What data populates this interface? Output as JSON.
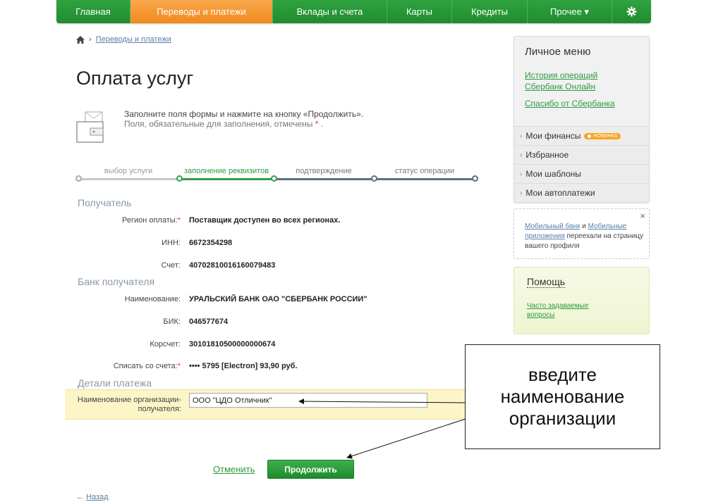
{
  "nav": {
    "items": [
      {
        "label": "Главная"
      },
      {
        "label": "Переводы и платежи"
      },
      {
        "label": "Вклады и счета"
      },
      {
        "label": "Карты"
      },
      {
        "label": "Кредиты"
      },
      {
        "label": "Прочее ▾"
      }
    ],
    "settings_icon": "gear-icon",
    "active_color": "#f39a2e",
    "base_color": "#21a038"
  },
  "breadcrumb": {
    "home_icon": "home-icon",
    "separator": "›",
    "link": "Переводы и платежи"
  },
  "page": {
    "title": "Оплата услуг"
  },
  "info": {
    "icon": "wallet-icon",
    "line1": "Заполните поля формы и нажмите на кнопку «Продолжить».",
    "line2": "Поля, обязательные для заполнения, отмечены",
    "required_mark": "*",
    "line2_end": "."
  },
  "steps": [
    {
      "label": "выбор услуги",
      "state": "done"
    },
    {
      "label": "заполнение реквизитов",
      "state": "current"
    },
    {
      "label": "подтверждение",
      "state": "next"
    },
    {
      "label": "статус операции",
      "state": "next"
    }
  ],
  "recipient": {
    "title": "Получатель",
    "fields": [
      {
        "label": "Регион оплаты:",
        "required": true,
        "value": "Поставщик доступен во всех регионах."
      },
      {
        "label": "ИНН:",
        "required": false,
        "value": "6672354298"
      },
      {
        "label": "Счет:",
        "required": false,
        "value": "40702810016160079483"
      }
    ]
  },
  "bank": {
    "title": "Банк получателя",
    "fields": [
      {
        "label": "Наименование:",
        "required": false,
        "value": "УРАЛЬСКИЙ БАНК ОАО \"СБЕРБАНК РОССИИ\""
      },
      {
        "label": "БИК:",
        "required": false,
        "value": "046577674"
      },
      {
        "label": "Корсчет:",
        "required": false,
        "value": "30101810500000000674"
      },
      {
        "label": "Списать со счета:",
        "required": true,
        "value": "•••• 5795  [Electron] 93,90   руб."
      }
    ]
  },
  "details": {
    "title": "Детали платежа",
    "org_label_line1": "Наименование организации-",
    "org_label_line2": "получателя:",
    "org_value": "ООО \"ЦДО Отличник\""
  },
  "actions": {
    "cancel": "Отменить",
    "continue": "Продолжить",
    "back_arrow": "←",
    "back": "Назад"
  },
  "sidebar": {
    "menu_title": "Личное меню",
    "link1_line1": "История операций",
    "link1_line2": "Сбербанк Онлайн",
    "link2": "Спасибо от Сбербанка",
    "items": [
      {
        "label": "Мои финансы",
        "badge": "НОВИНКА"
      },
      {
        "label": "Избранное"
      },
      {
        "label": "Мои шаблоны"
      },
      {
        "label": "Мои автоплатежи"
      }
    ],
    "notice": {
      "part1": "Мобильный банк",
      "part2": " и ",
      "part3": "Мобильные приложения",
      "part4": " переехали на страницу вашего профиля",
      "close": "×"
    },
    "help": {
      "title": "Помощь",
      "link": "Часто задаваемые вопросы"
    }
  },
  "annotation": {
    "line1": "введите",
    "line2": "наименование",
    "line3": "организации"
  }
}
